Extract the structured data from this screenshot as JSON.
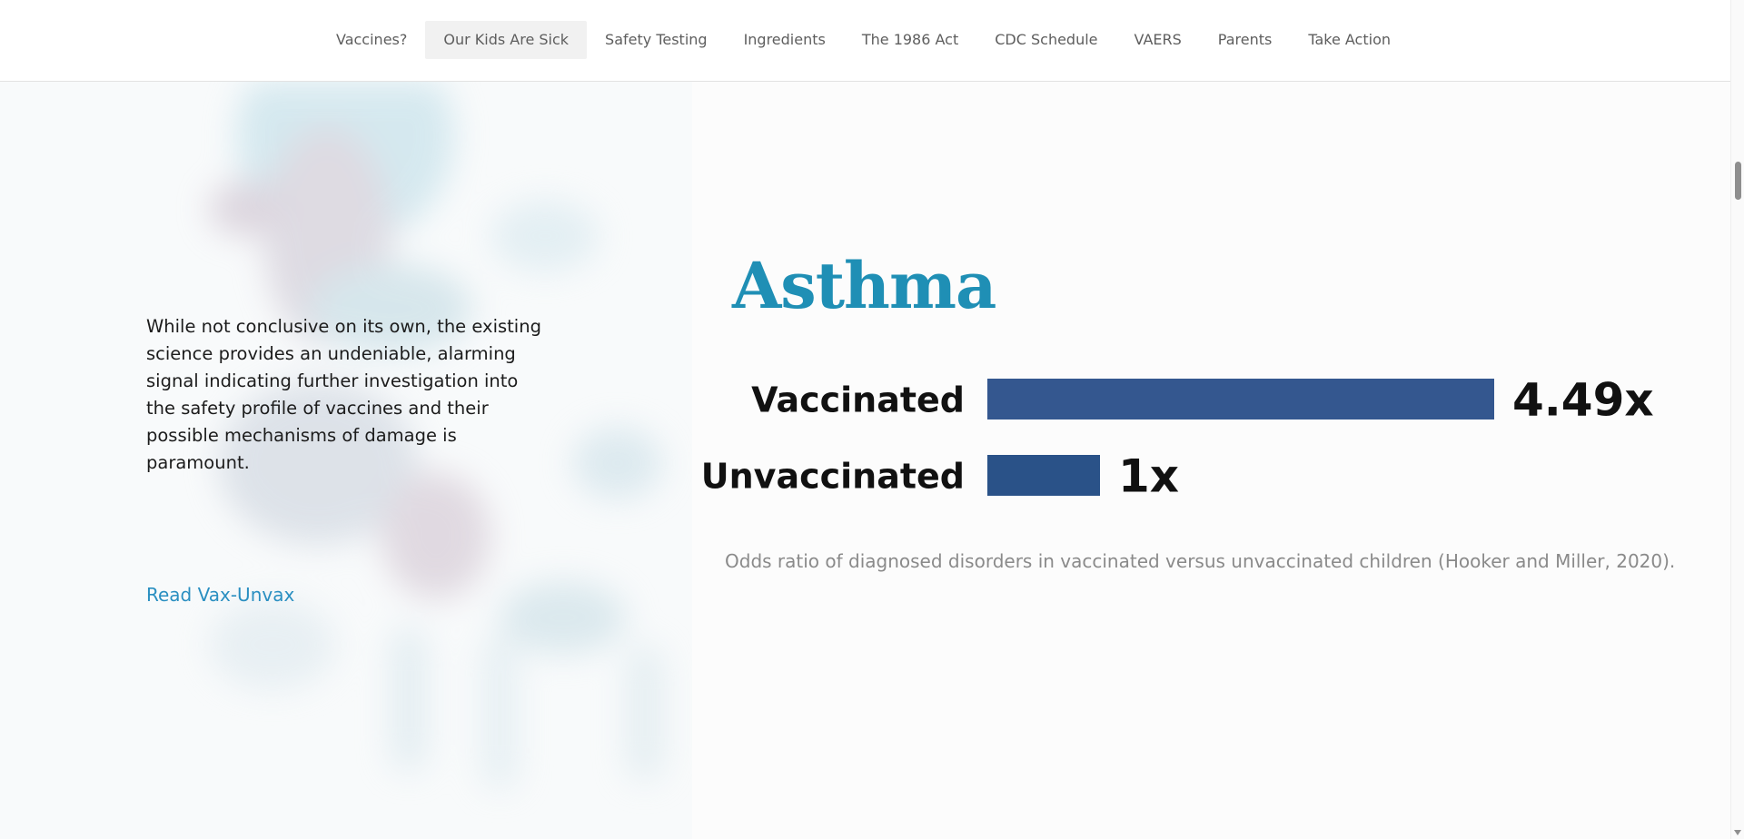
{
  "nav": {
    "items": [
      {
        "label": "Vaccines?",
        "active": false
      },
      {
        "label": "Our Kids Are Sick",
        "active": true
      },
      {
        "label": "Safety Testing",
        "active": false
      },
      {
        "label": "Ingredients",
        "active": false
      },
      {
        "label": "The 1986 Act",
        "active": false
      },
      {
        "label": "CDC Schedule",
        "active": false
      },
      {
        "label": "VAERS",
        "active": false
      },
      {
        "label": "Parents",
        "active": false
      },
      {
        "label": "Take Action",
        "active": false
      }
    ]
  },
  "left": {
    "paragraph": "While not conclusive on its own, the existing science provides an undeniable, alarming signal indicating further investigation into the safety profile of vaccines and their possible mechanisms of damage is paramount.",
    "link": "Read Vax-Unvax"
  },
  "right": {
    "caption": "Odds ratio of diagnosed disorders in vaccinated versus unvaccinated children (Hooker and Miller, 2020)."
  },
  "colors": {
    "accent": "#1f8fb5",
    "link": "#2a8fc1",
    "bar_vaccinated": "#34578f",
    "bar_unvaccinated": "#2a5288"
  },
  "chart_data": {
    "type": "bar",
    "orientation": "horizontal",
    "title": "Asthma",
    "categories": [
      "Vaccinated",
      "Unvaccinated"
    ],
    "values": [
      4.49,
      1
    ],
    "value_labels": [
      "4.49x",
      "1x"
    ],
    "xlim": [
      0,
      4.49
    ],
    "grid": false,
    "legend": "none"
  }
}
